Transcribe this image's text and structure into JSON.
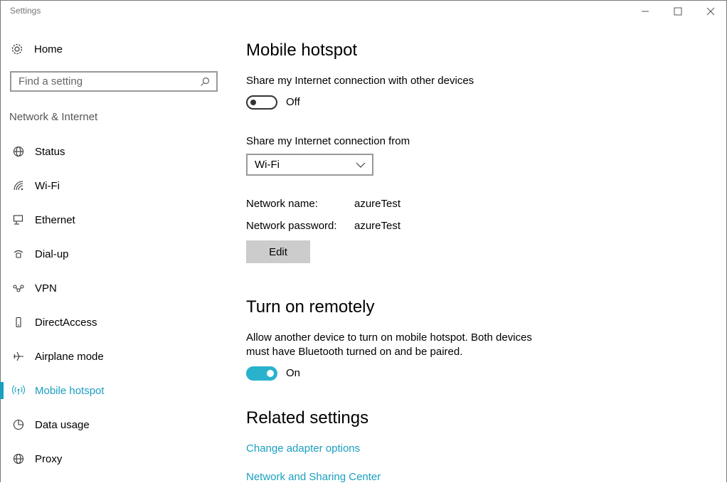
{
  "window": {
    "title": "Settings"
  },
  "nav": {
    "home_label": "Home",
    "search_placeholder": "Find a setting",
    "section_label": "Network & Internet",
    "items": [
      {
        "label": "Status",
        "icon": "globe-icon"
      },
      {
        "label": "Wi-Fi",
        "icon": "wifi-icon"
      },
      {
        "label": "Ethernet",
        "icon": "ethernet-icon"
      },
      {
        "label": "Dial-up",
        "icon": "dialup-icon"
      },
      {
        "label": "VPN",
        "icon": "vpn-icon"
      },
      {
        "label": "DirectAccess",
        "icon": "phone-icon"
      },
      {
        "label": "Airplane mode",
        "icon": "airplane-icon"
      },
      {
        "label": "Mobile hotspot",
        "icon": "hotspot-icon",
        "active": true
      },
      {
        "label": "Data usage",
        "icon": "pie-chart-icon"
      },
      {
        "label": "Proxy",
        "icon": "globe-icon"
      }
    ]
  },
  "main": {
    "title": "Mobile hotspot",
    "share_label": "Share my Internet connection with other devices",
    "share_toggle_state": "Off",
    "share_from_label": "Share my Internet connection from",
    "share_from_value": "Wi-Fi",
    "network_name_label": "Network name:",
    "network_name_value": "azureTest",
    "network_password_label": "Network password:",
    "network_password_value": "azureTest",
    "edit_label": "Edit",
    "remote_title": "Turn on remotely",
    "remote_desc_line1": "Allow another device to turn on mobile hotspot. Both devices",
    "remote_desc_line2": "must have Bluetooth turned on and be paired.",
    "remote_toggle_state": "On",
    "related_title": "Related settings",
    "related_links": [
      "Change adapter options",
      "Network and Sharing Center"
    ]
  },
  "colors": {
    "accent": "#1a9fc0",
    "toggle_on": "#29b2cc"
  }
}
